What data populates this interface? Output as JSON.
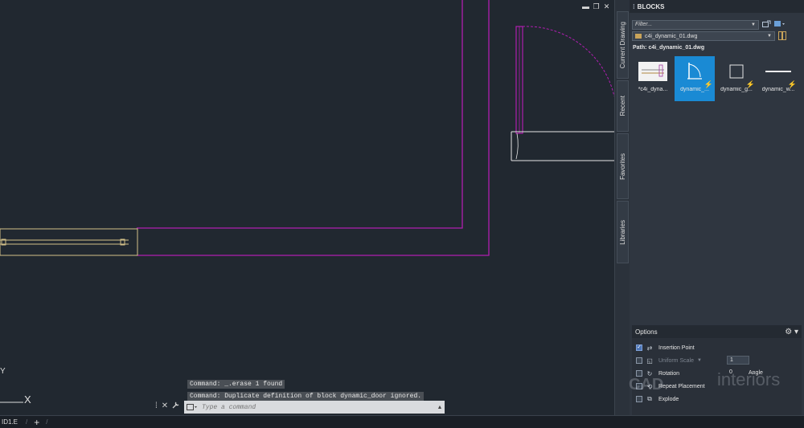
{
  "window_controls": [
    "▬",
    "❐",
    "✕"
  ],
  "ucs": {
    "y_label": "Y",
    "x_label": "X"
  },
  "command": {
    "history": [
      "Command: _.erase 1 found",
      "Command: Duplicate definition of block dynamic_door  ignored."
    ],
    "placeholder": "Type a command",
    "tools": [
      "⁞",
      "✕",
      "🔧"
    ]
  },
  "tabs": {
    "active": "ID1.E",
    "add_label": "+"
  },
  "side_tabs": [
    "Current Drawing",
    "Recent",
    "Favorites",
    "Libraries"
  ],
  "palette": {
    "title": "BLOCKS",
    "filter_placeholder": "Filter...",
    "file": "c4i_dynamic_01.dwg",
    "path": "Path: c4i_dynamic_01.dwg",
    "blocks": [
      {
        "label": "*c4i_dyna...",
        "dynamic": false,
        "selected": false,
        "icon": "drawing-preview-icon"
      },
      {
        "label": "dynamic_...",
        "dynamic": true,
        "selected": true,
        "icon": "door-swing-icon"
      },
      {
        "label": "dynamic_g...",
        "dynamic": true,
        "selected": false,
        "icon": "rectangle-icon"
      },
      {
        "label": "dynamic_w...",
        "dynamic": true,
        "selected": false,
        "icon": "wall-line-icon"
      }
    ]
  },
  "options": {
    "title": "Options",
    "insertion_point": "Insertion Point",
    "uniform_scale": "Uniform Scale",
    "scale_value": "1",
    "rotation": "Rotation",
    "rotation_value": "0",
    "angle_label": "Angle",
    "repeat_placement": "Repeat Placement",
    "explode": "Explode",
    "insertion_point_checked": true
  },
  "watermark": {
    "left": "CAD",
    "right": "interiors"
  }
}
